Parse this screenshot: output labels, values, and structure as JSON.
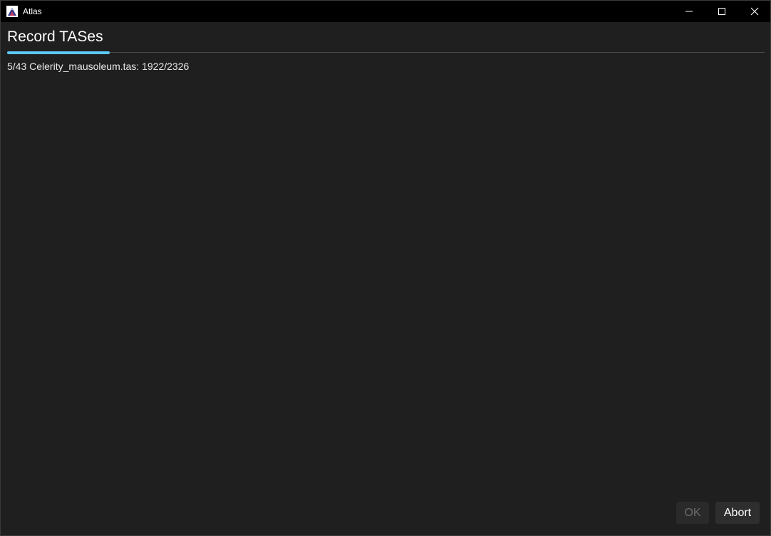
{
  "window": {
    "title": "Atlas",
    "app_icon": "atlas-app-icon",
    "controls": {
      "minimize_icon": "minimize-icon",
      "maximize_icon": "maximize-icon",
      "close_icon": "close-icon"
    }
  },
  "dialog": {
    "heading": "Record TASes",
    "progress_fraction": 0.135,
    "status": "5/43 Celerity_mausoleum.tas: 1922/2326",
    "buttons": {
      "ok_label": "OK",
      "ok_enabled": false,
      "abort_label": "Abort"
    }
  },
  "colors": {
    "background": "#1f1f1f",
    "titlebar": "#000000",
    "accent": "#5bc8f5",
    "button": "#2e2e2e",
    "disabled_text": "#6b6b6b"
  }
}
